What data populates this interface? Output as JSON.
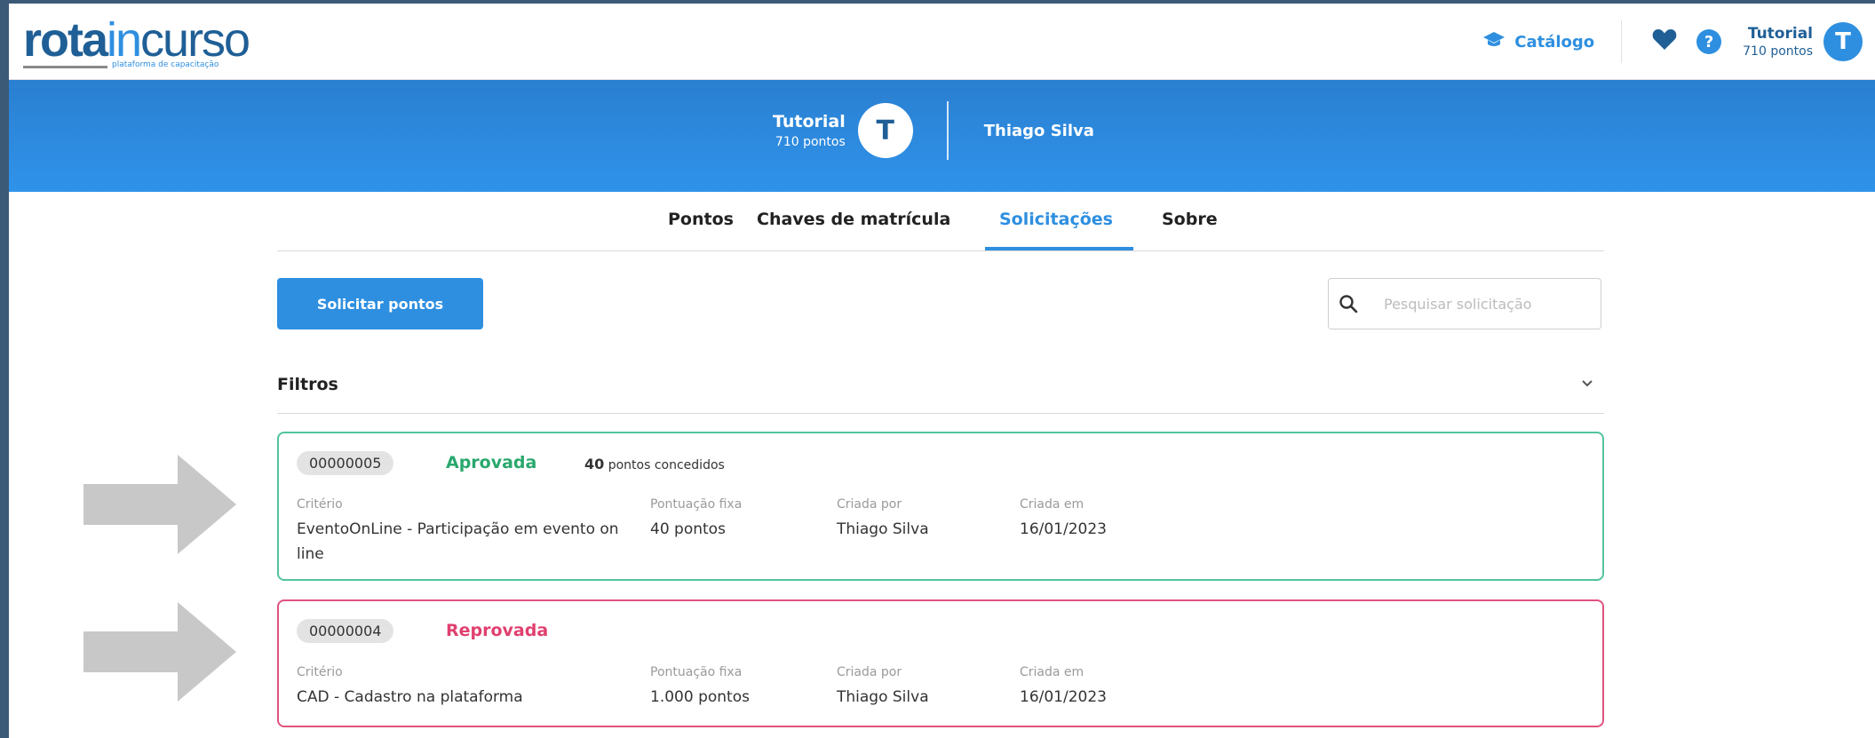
{
  "app": {
    "logo_rota": "rota",
    "logo_in": "in",
    "logo_curso": "curso",
    "logo_tagline": "plataforma de capacitação"
  },
  "topbar": {
    "catalog_label": "Catálogo",
    "user_name": "Tutorial",
    "user_points": "710 pontos",
    "avatar_letter": "T"
  },
  "hero": {
    "user_name": "Tutorial",
    "user_points": "710 pontos",
    "avatar_letter": "T",
    "person_name": "Thiago Silva"
  },
  "tabs": [
    {
      "label": "Pontos",
      "active": false
    },
    {
      "label": "Chaves de matrícula",
      "active": false
    },
    {
      "label": "Solicitações",
      "active": true
    },
    {
      "label": "Sobre",
      "active": false
    }
  ],
  "actions": {
    "request_button": "Solicitar pontos",
    "search_placeholder": "Pesquisar solicitação"
  },
  "filters": {
    "label": "Filtros"
  },
  "requests": [
    {
      "id": "00000005",
      "status": "Aprovada",
      "granted_points": "40",
      "granted_text": "pontos concedidos",
      "criterion_label": "Critério",
      "criterion": "EventoOnLine - Participação em evento on line",
      "score_label": "Pontuação fixa",
      "score": "40 pontos",
      "created_by_label": "Criada por",
      "created_by": "Thiago Silva",
      "created_at_label": "Criada em",
      "created_at": "16/01/2023"
    },
    {
      "id": "00000004",
      "status": "Reprovada",
      "criterion_label": "Critério",
      "criterion": "CAD - Cadastro na plataforma",
      "score_label": "Pontuação fixa",
      "score": "1.000 pontos",
      "created_by_label": "Criada por",
      "created_by": "Thiago Silva",
      "created_at_label": "Criada em",
      "created_at": "16/01/2023"
    }
  ],
  "colors": {
    "primary": "#2e8fe0",
    "brand_dark": "#1f5f96",
    "approved": "#29a86d",
    "rejected": "#e0406f",
    "arrow": "#c8c8c8"
  }
}
